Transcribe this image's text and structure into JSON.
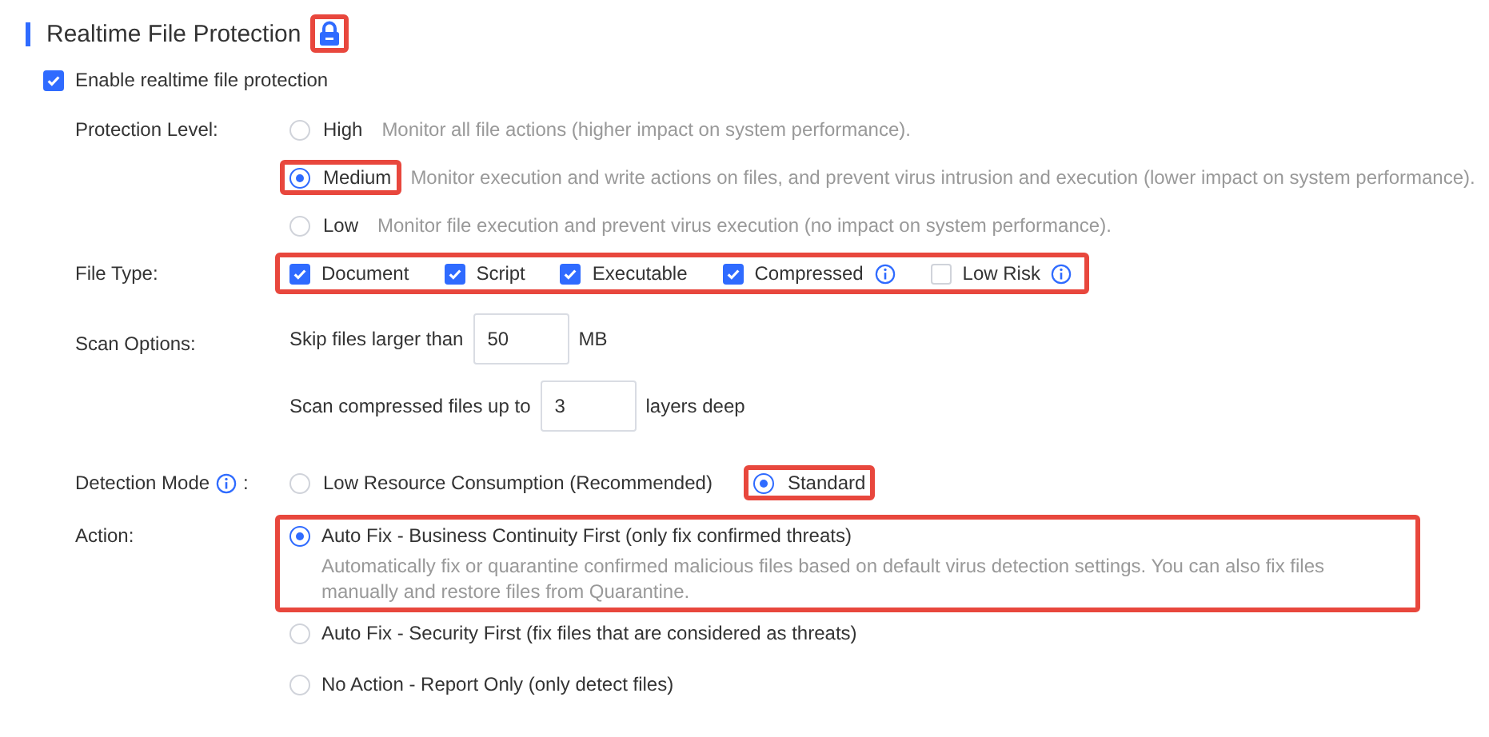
{
  "section": {
    "title": "Realtime File Protection",
    "lock_highlighted": true
  },
  "enable": {
    "label": "Enable realtime file protection",
    "checked": true
  },
  "protection_level": {
    "label": "Protection Level:",
    "options": [
      {
        "name": "High",
        "description": "Monitor all file actions (higher impact on system performance).",
        "selected": false,
        "highlighted": false
      },
      {
        "name": "Medium",
        "description": "Monitor execution and write actions on files, and prevent virus intrusion and execution (lower impact on system performance).",
        "selected": true,
        "highlighted": true
      },
      {
        "name": "Low",
        "description": "Monitor file execution and prevent virus execution (no impact on system performance).",
        "selected": false,
        "highlighted": false
      }
    ]
  },
  "file_type": {
    "label": "File Type:",
    "highlighted": true,
    "options": [
      {
        "label": "Document",
        "checked": true,
        "info": false
      },
      {
        "label": "Script",
        "checked": true,
        "info": false
      },
      {
        "label": "Executable",
        "checked": true,
        "info": false
      },
      {
        "label": "Compressed",
        "checked": true,
        "info": true
      },
      {
        "label": "Low Risk",
        "checked": false,
        "info": true
      }
    ]
  },
  "scan_options": {
    "label": "Scan Options:",
    "rows": [
      {
        "before": "Skip files larger than",
        "value": "50",
        "after": "MB"
      },
      {
        "before": "Scan compressed files up to",
        "value": "3",
        "after": "layers deep"
      }
    ]
  },
  "detection_mode": {
    "label": "Detection Mode",
    "info": true,
    "colon": ":",
    "options": [
      {
        "label": "Low Resource Consumption (Recommended)",
        "selected": false,
        "highlighted": false
      },
      {
        "label": "Standard",
        "selected": true,
        "highlighted": true
      }
    ]
  },
  "action": {
    "label": "Action:",
    "options": [
      {
        "label": "Auto Fix - Business Continuity First (only fix confirmed threats)",
        "description": "Automatically fix or quarantine confirmed malicious files based on default virus detection settings. You can also fix files manually and restore files from Quarantine.",
        "selected": true,
        "highlighted": true
      },
      {
        "label": "Auto Fix - Security First (fix files that are considered as threats)",
        "selected": false,
        "highlighted": false
      },
      {
        "label": "No Action - Report Only (only detect files)",
        "selected": false,
        "highlighted": false
      }
    ]
  }
}
